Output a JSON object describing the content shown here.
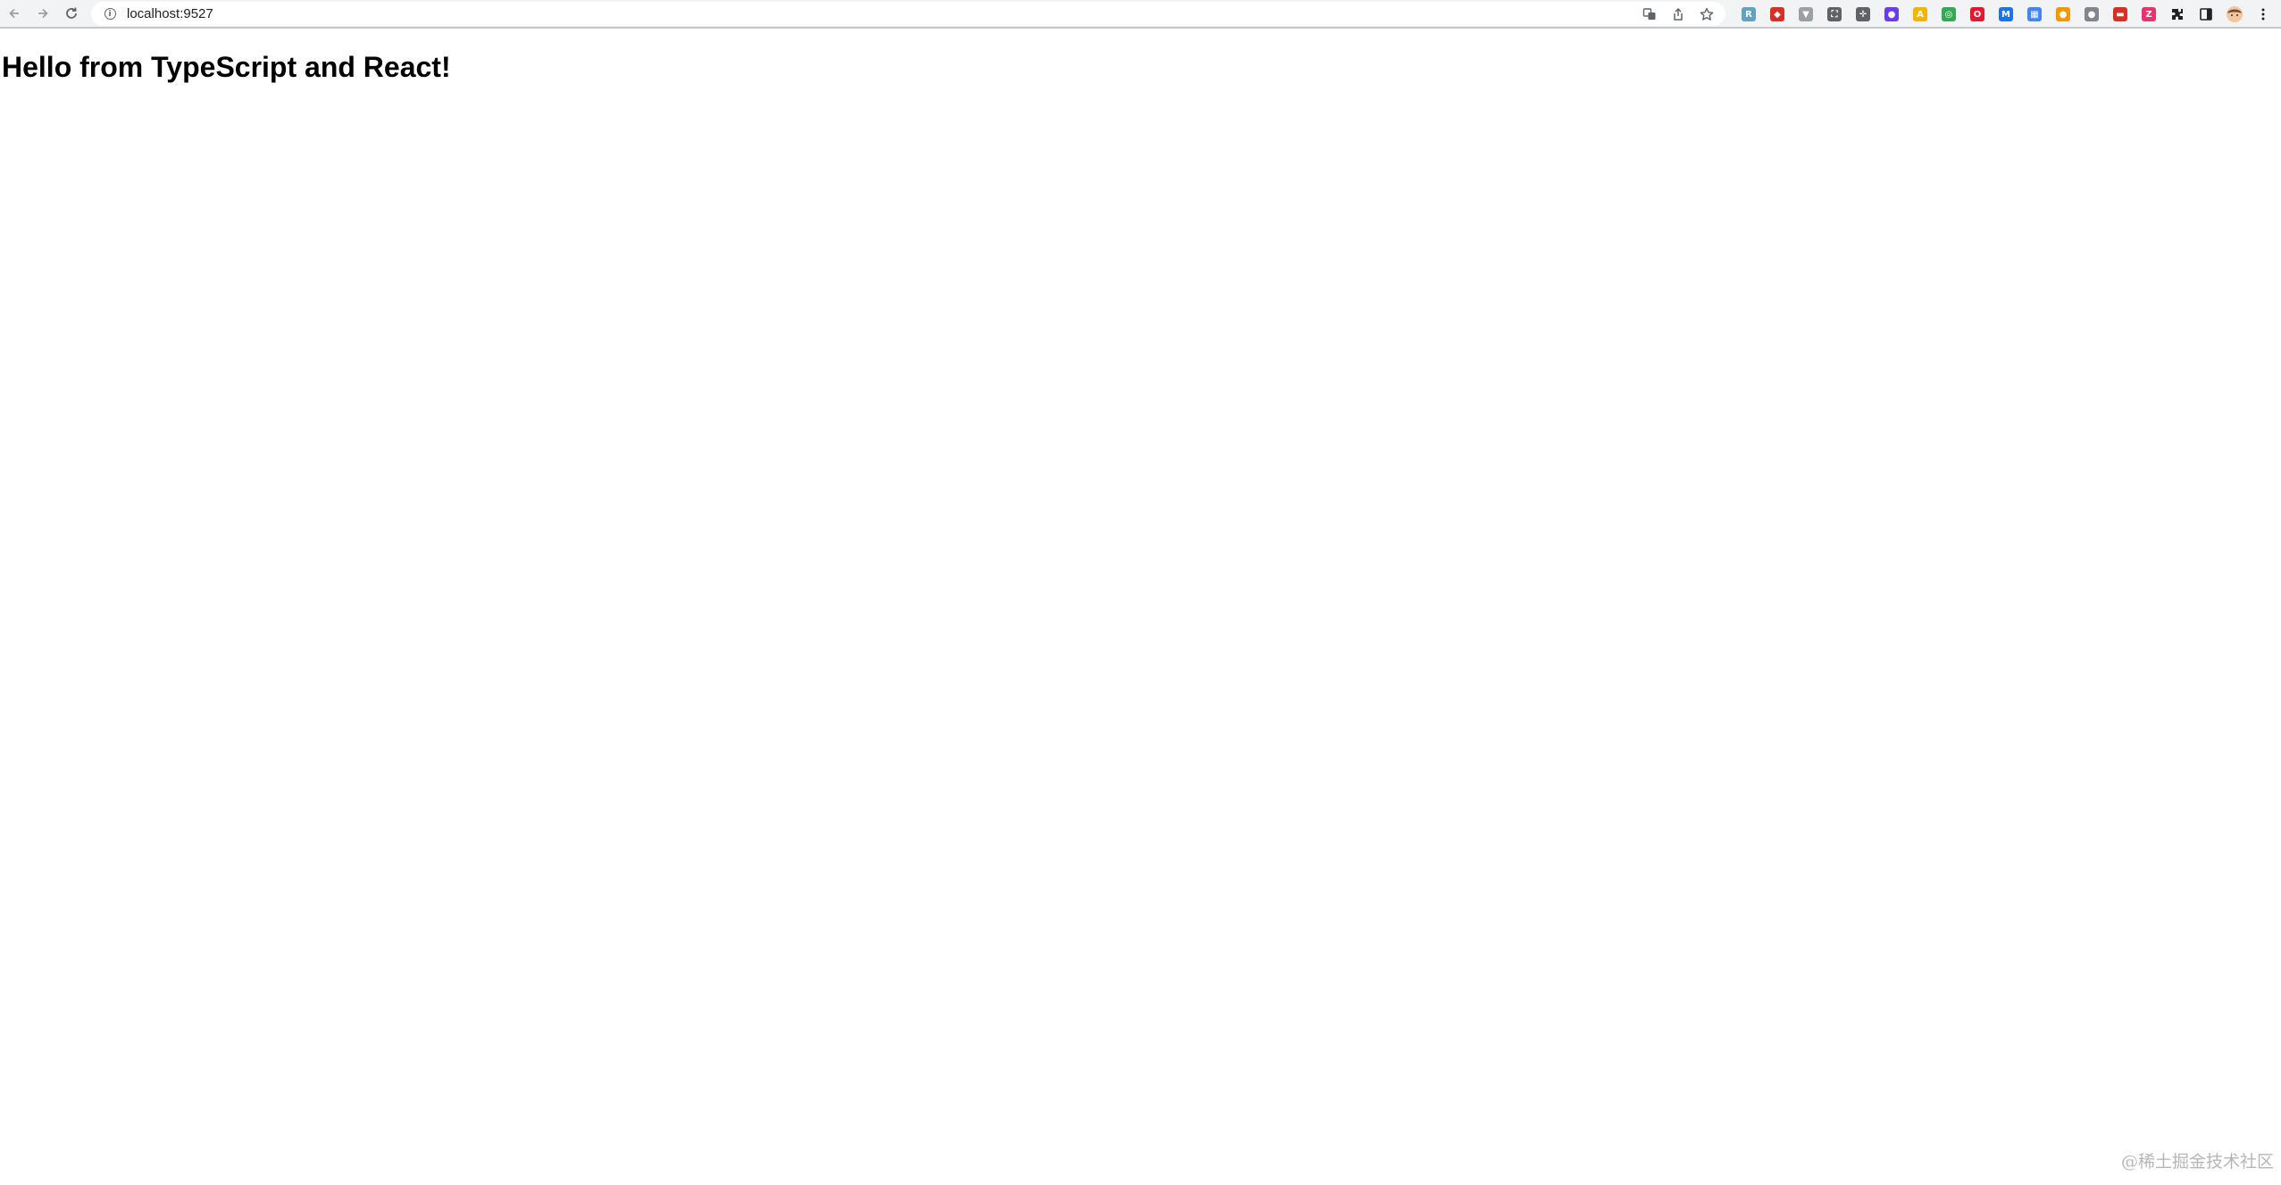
{
  "browser": {
    "url": "localhost:9527",
    "nav": {
      "back_icon": "arrow-left-icon",
      "forward_icon": "arrow-right-icon",
      "reload_icon": "reload-icon"
    },
    "site_info_icon": "info-icon",
    "omnibox_actions": [
      "translate-icon",
      "share-icon",
      "bookmark-star-icon"
    ],
    "extensions": [
      {
        "name": "ext-react-devtools-icon",
        "color": "#61a3c1",
        "glyph": "R"
      },
      {
        "name": "ext-red-tool-icon",
        "color": "#d93025",
        "glyph": "◆"
      },
      {
        "name": "ext-funnel-icon",
        "color": "#9aa0a6",
        "glyph": "▼"
      },
      {
        "name": "ext-screenshot-icon",
        "color": "#5f6368",
        "glyph": "⛶"
      },
      {
        "name": "ext-ruler-icon",
        "color": "#5f6368",
        "glyph": "✛"
      },
      {
        "name": "ext-colorpicker-icon",
        "color": "#6a3de8",
        "glyph": "●"
      },
      {
        "name": "ext-yellow-a-icon",
        "color": "#f4b400",
        "glyph": "A"
      },
      {
        "name": "ext-chrome-icon",
        "color": "#34a853",
        "glyph": "◎"
      },
      {
        "name": "ext-opera-icon",
        "color": "#e3192d",
        "glyph": "O"
      },
      {
        "name": "ext-blue-m-icon",
        "color": "#1a73e8",
        "glyph": "M"
      },
      {
        "name": "ext-grid-icon",
        "color": "#4285f4",
        "glyph": "▦"
      },
      {
        "name": "ext-orange-circle-icon",
        "color": "#f29900",
        "glyph": "●"
      },
      {
        "name": "ext-gray-circle-icon",
        "color": "#80868b",
        "glyph": "●"
      },
      {
        "name": "ext-red-bar-icon",
        "color": "#d93025",
        "glyph": "▬"
      },
      {
        "name": "ext-pink-z-icon",
        "color": "#e8336b",
        "glyph": "Z"
      }
    ],
    "toolbar_right": [
      "puzzle-extensions-icon",
      "side-panel-icon",
      "profile-avatar-icon",
      "kebab-menu-icon"
    ]
  },
  "page": {
    "heading": "Hello from TypeScript and React!"
  },
  "watermark": "@稀土掘金技术社区"
}
